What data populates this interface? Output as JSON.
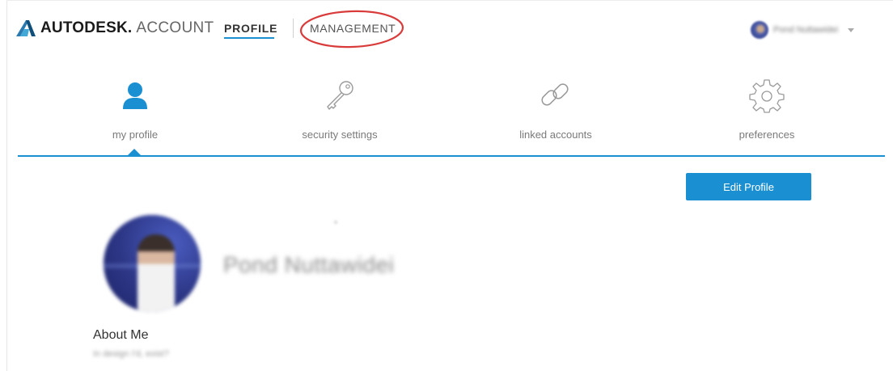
{
  "header": {
    "brand": "AUTODESK.",
    "brand_suffix": "ACCOUNT",
    "nav": {
      "profile": "PROFILE",
      "management": "MANAGEMENT"
    },
    "user": {
      "name": "Pond Nuttawidei"
    }
  },
  "tabs": [
    {
      "label": "my profile",
      "icon": "person-icon",
      "active": true
    },
    {
      "label": "security settings",
      "icon": "key-icon",
      "active": false
    },
    {
      "label": "linked accounts",
      "icon": "chain-link-icon",
      "active": false
    },
    {
      "label": "preferences",
      "icon": "gear-icon",
      "active": false
    }
  ],
  "profile": {
    "edit_button": "Edit Profile",
    "display_name": "Pond Nuttawidei",
    "about_title": "About Me",
    "about_text": "In design I'd, exist?"
  },
  "colors": {
    "accent": "#1a8fd2",
    "annotation": "#d93b3b"
  }
}
